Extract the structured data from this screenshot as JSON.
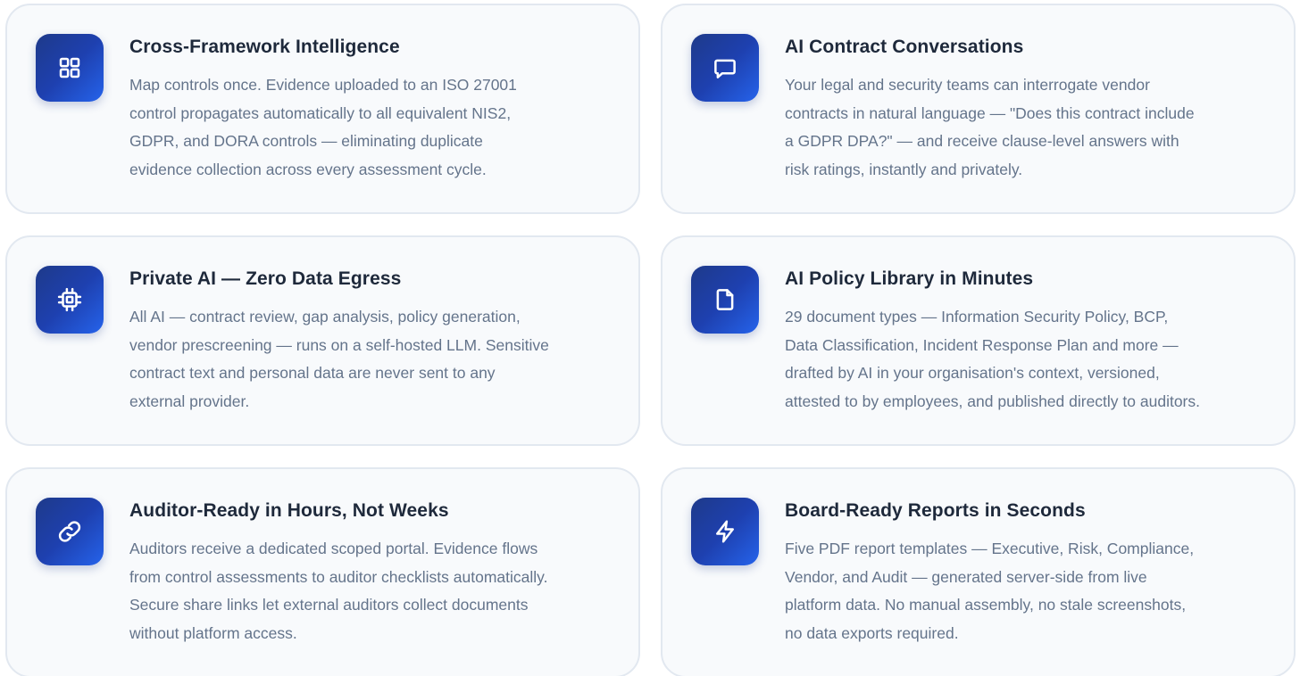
{
  "features": [
    {
      "title": "Cross-Framework Intelligence",
      "icon": "grid-icon",
      "lines": [
        "Map controls once. Evidence uploaded to an ISO 27001",
        "control propagates automatically to all equivalent NIS2,",
        "GDPR, and DORA controls — eliminating duplicate",
        "evidence collection across every assessment cycle."
      ]
    },
    {
      "title": "AI Contract Conversations",
      "icon": "chat-bubble-icon",
      "lines": [
        "Your legal and security teams can interrogate vendor",
        "contracts in natural language — \"Does this contract include",
        "a GDPR DPA?\" — and receive clause-level answers with",
        "risk ratings, instantly and privately."
      ]
    },
    {
      "title": "Private AI — Zero Data Egress",
      "icon": "cpu-chip-icon",
      "lines": [
        "All AI — contract review, gap analysis, policy generation,",
        "vendor prescreening — runs on a self-hosted LLM. Sensitive",
        "contract text and personal data are never sent to any",
        "external provider."
      ]
    },
    {
      "title": "AI Policy Library in Minutes",
      "icon": "document-icon",
      "lines": [
        "29 document types — Information Security Policy, BCP,",
        "Data Classification, Incident Response Plan and more —",
        "drafted by AI in your organisation's context, versioned,",
        "attested to by employees, and published directly to auditors."
      ]
    },
    {
      "title": "Auditor-Ready in Hours, Not Weeks",
      "icon": "link-icon",
      "lines": [
        "Auditors receive a dedicated scoped portal. Evidence flows",
        "from control assessments to auditor checklists automatically.",
        "Secure share links let external auditors collect documents",
        "without platform access."
      ]
    },
    {
      "title": "Board-Ready Reports in Seconds",
      "icon": "lightning-bolt-icon",
      "lines": [
        "Five PDF report templates — Executive, Risk, Compliance,",
        "Vendor, and Audit — generated server-side from live",
        "platform data. No manual assembly, no stale screenshots,",
        "no data exports required."
      ]
    }
  ],
  "colors": {
    "icon_gradient_start": "#1e3a8a",
    "icon_gradient_end": "#2563eb",
    "card_background": "#f8fafc",
    "card_border": "#e2e8f0",
    "title": "#1e293b",
    "body_text": "#64748b"
  }
}
